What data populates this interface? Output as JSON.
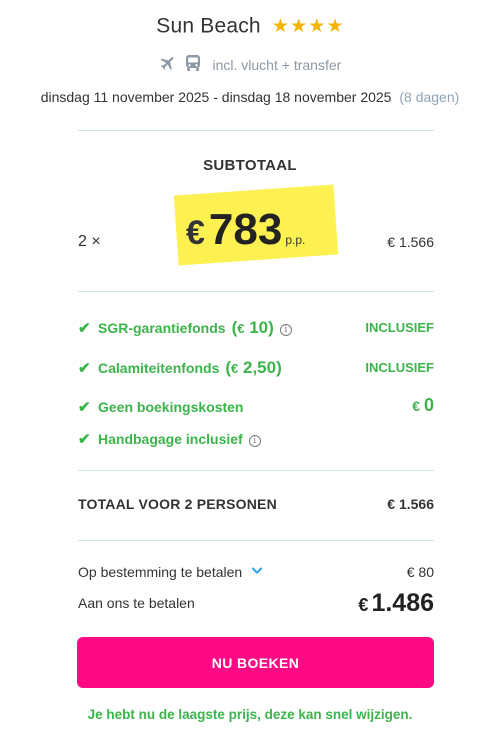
{
  "hotel": {
    "name": "Sun Beach",
    "stars": 4,
    "star_color": "#f5b400"
  },
  "includes": {
    "icons": [
      "plane-icon",
      "bus-icon"
    ],
    "text": "incl. vlucht + transfer"
  },
  "dates": {
    "range": "dinsdag 11 november 2025 - dinsdag 18 november 2025",
    "duration": "(8 dagen)"
  },
  "subtotal": {
    "label": "SUBTOTAAL",
    "quantity": "2 ×",
    "currency": "€",
    "price_per_person": "783",
    "per_person_suffix": "p.p.",
    "total": "€ 1.566"
  },
  "features": [
    {
      "label": "SGR-garantiefonds",
      "amount": "10",
      "currency": "€",
      "info": true,
      "right": "INCLUSIEF"
    },
    {
      "label": "Calamiteitenfonds",
      "amount": "2,50",
      "currency": "€",
      "info": false,
      "right": "INCLUSIEF"
    },
    {
      "label": "Geen boekingskosten",
      "right_currency": "€",
      "right_amount": "0"
    },
    {
      "label": "Handbagage inclusief",
      "info": true
    }
  ],
  "total": {
    "label": "TOTAAL VOOR 2 PERSONEN",
    "value": "€ 1.566"
  },
  "destination": {
    "label": "Op bestemming te betalen",
    "value": "€ 80"
  },
  "pay_now": {
    "label": "Aan ons te betalen",
    "currency": "€",
    "amount": "1.486"
  },
  "book_button": {
    "label": "NU BOEKEN",
    "color": "#ff0a84"
  },
  "footer_note": "Je hebt nu de laagste prijs, deze kan snel wijzigen.",
  "colors": {
    "accent_green": "#3bb54a",
    "divider": "#cfe3ea",
    "highlight": "#fdf152",
    "chevron": "#2ea3e8"
  }
}
